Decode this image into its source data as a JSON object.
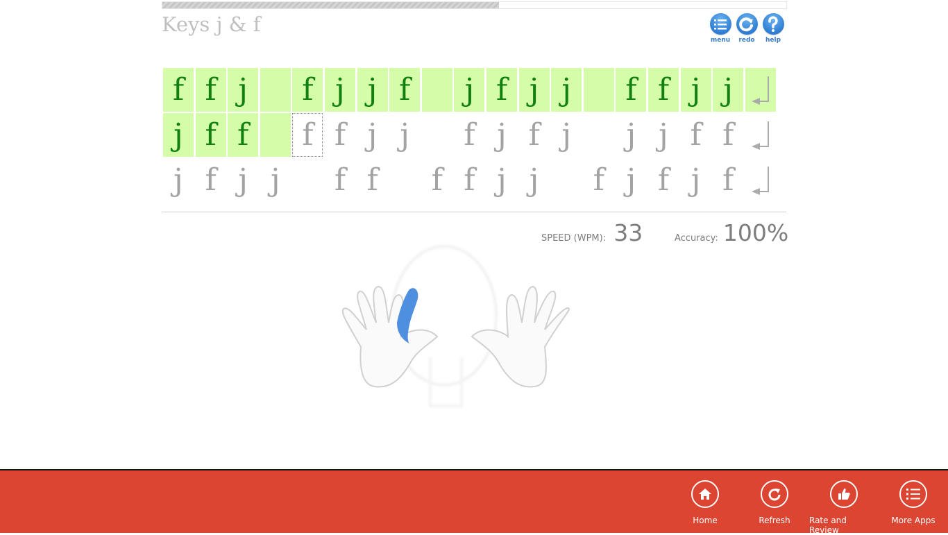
{
  "lesson": {
    "title": "Keys j & f",
    "progress_fraction": 0.54
  },
  "toolbar": {
    "items": [
      {
        "id": "menu",
        "label": "menu",
        "icon": "menu-list-icon"
      },
      {
        "id": "redo",
        "label": "redo",
        "icon": "redo-icon"
      },
      {
        "id": "help",
        "label": "help",
        "icon": "help-icon"
      }
    ]
  },
  "typing_grid": {
    "enter_symbol": "↵",
    "rows": [
      {
        "chars": [
          "f",
          "f",
          "j",
          " ",
          "f",
          "j",
          "j",
          "f",
          " ",
          "j",
          "f",
          "j",
          "j",
          " ",
          "f",
          "f",
          "j",
          "j",
          "⏎"
        ],
        "typed_count": 19
      },
      {
        "chars": [
          "j",
          "f",
          "f",
          " ",
          "f",
          "f",
          "j",
          "j",
          " ",
          "f",
          "j",
          "f",
          "j",
          " ",
          "j",
          "j",
          "f",
          "f",
          "⏎"
        ],
        "typed_count": 4,
        "cursor_index": 4
      },
      {
        "chars": [
          "j",
          "f",
          "j",
          "j",
          " ",
          "f",
          "f",
          " ",
          "f",
          "f",
          "j",
          "j",
          " ",
          "f",
          "j",
          "f",
          "j",
          "f",
          "⏎"
        ],
        "typed_count": 0
      }
    ]
  },
  "stats": {
    "speed_label": "SPEED (WPM):",
    "speed_value": "33",
    "accuracy_label": "Accuracy:",
    "accuracy_value": "100%"
  },
  "hands": {
    "highlighted_finger": "left-index",
    "highlight_color": "#4f8fe0"
  },
  "app_bar": {
    "background": "#dc4532",
    "buttons": [
      {
        "id": "home",
        "label": "Home",
        "icon": "home-icon"
      },
      {
        "id": "refresh",
        "label": "Refresh",
        "icon": "refresh-icon"
      },
      {
        "id": "rate",
        "label": "Rate and Review",
        "icon": "thumbs-up-icon"
      },
      {
        "id": "more",
        "label": "More Apps",
        "icon": "list-icon"
      }
    ]
  }
}
